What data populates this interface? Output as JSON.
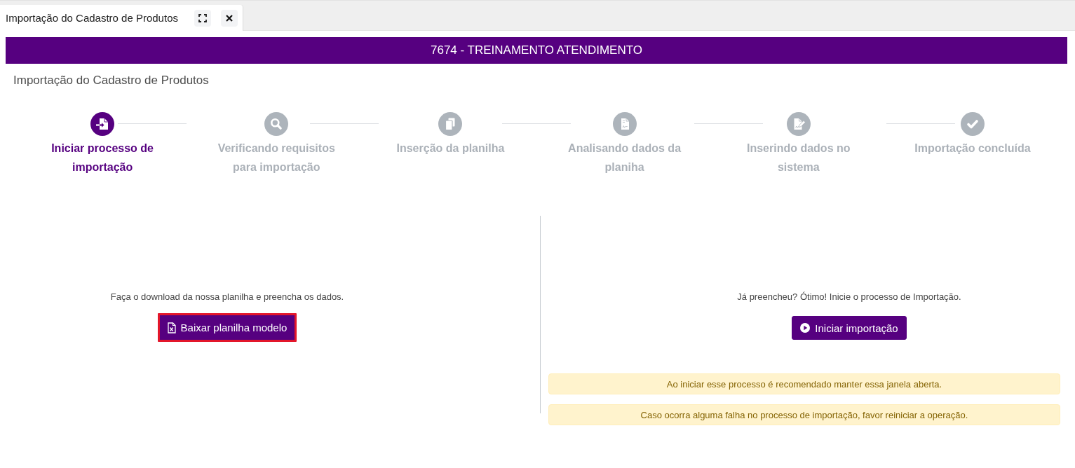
{
  "tab": {
    "title": "Importação do Cadastro de Produtos",
    "selected": true
  },
  "header": {
    "title": "7674 - TREINAMENTO ATENDIMENTO"
  },
  "page_title": "Importação do Cadastro de Produtos",
  "steps": [
    {
      "label": "Iniciar processo de importação",
      "active": true
    },
    {
      "label": "Verificando requisitos para importação",
      "active": false
    },
    {
      "label": "Inserção da planilha",
      "active": false
    },
    {
      "label": "Analisando dados da planiha",
      "active": false
    },
    {
      "label": "Inserindo dados no sistema",
      "active": false
    },
    {
      "label": "Importação concluída",
      "active": false
    }
  ],
  "download_panel": {
    "text": "Faça o download da nossa planilha e preencha os dados.",
    "button": {
      "label": "Baixar planilha modelo",
      "highlighted": true
    }
  },
  "import_panel": {
    "text": "Já preencheu? Ótimo! Inicie o processo de Importação.",
    "button": {
      "label": "Iniciar importação",
      "highlighted": false
    },
    "alerts": [
      "Ao iniciar esse processo é recomendado manter essa janela aberta.",
      "Caso ocorra alguma falha no processo de importação, favor reiniciar a operação."
    ]
  }
}
